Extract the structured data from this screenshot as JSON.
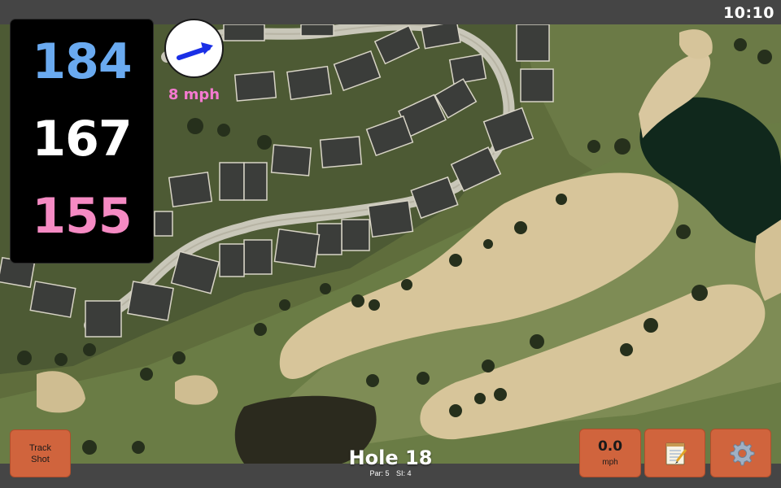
{
  "status_bar": {
    "time": "10:10"
  },
  "distances": {
    "back": "184",
    "center": "167",
    "front": "155"
  },
  "wind": {
    "speed_label": "8 mph",
    "direction": "arrow-right-up-icon"
  },
  "hole": {
    "title": "Hole 18",
    "par_label": "Par: 5",
    "si_label": "SI: 4"
  },
  "buttons": {
    "track_shot": {
      "line1": "Track",
      "line2": "Shot"
    },
    "wind_gauge": {
      "value": "0.0",
      "unit": "mph"
    },
    "notes": {
      "icon": "notepad-icon"
    },
    "settings": {
      "icon": "gear-icon"
    }
  },
  "colors": {
    "back_distance": "#6aaaf0",
    "center_distance": "#ffffff",
    "front_distance": "#f58ac3",
    "wind_speed": "#f57ad0",
    "button_bg": "#d0643d",
    "bar_bg": "#454545"
  }
}
